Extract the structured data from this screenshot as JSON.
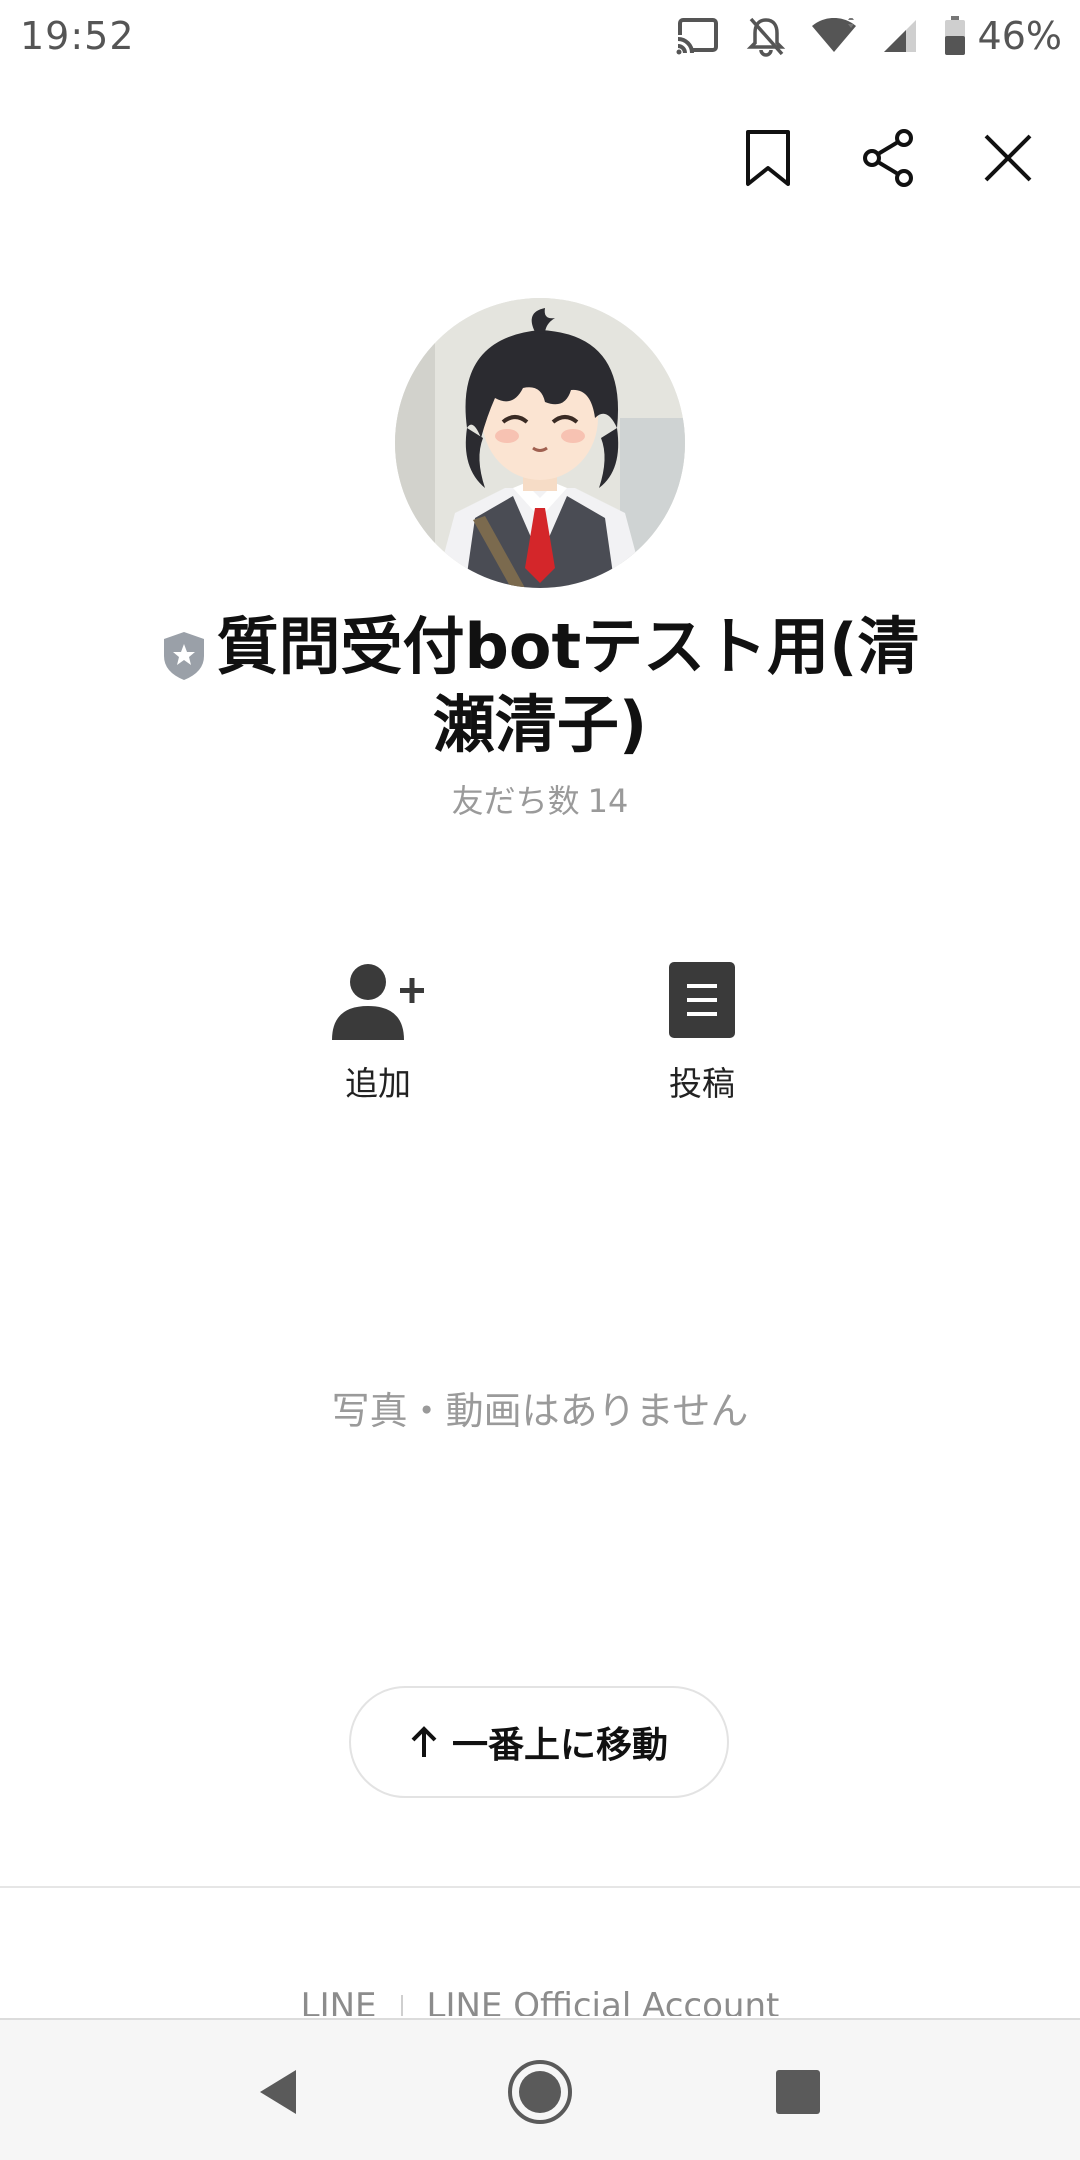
{
  "status_bar": {
    "time": "19:52",
    "battery_percent": "46%",
    "icons": [
      "cast-icon",
      "notifications-off-icon",
      "wifi-icon",
      "cell-signal-icon",
      "battery-icon"
    ]
  },
  "top_actions": {
    "icons": [
      "bookmark-icon",
      "share-icon",
      "close-icon"
    ]
  },
  "profile": {
    "name": "質問受付botテスト用(清瀬清子)",
    "badge_icon": "official-shield-icon",
    "friends_label": "友だち数",
    "friends_count": "14"
  },
  "actions": [
    {
      "label": "追加",
      "icon": "add-friend-icon"
    },
    {
      "label": "投稿",
      "icon": "posts-icon"
    }
  ],
  "media": {
    "empty_message": "写真・動画はありません"
  },
  "scroll_top": {
    "label": "一番上に移動",
    "icon": "arrow-up-icon"
  },
  "footer": {
    "links": [
      "LINE",
      "LINE Official Account"
    ]
  },
  "nav_bar": {
    "icons": [
      "back-icon",
      "home-icon",
      "recents-icon"
    ]
  },
  "colors": {
    "text_primary": "#111111",
    "text_muted": "#9a9a9a",
    "icon_dark": "#3a3a3a"
  }
}
